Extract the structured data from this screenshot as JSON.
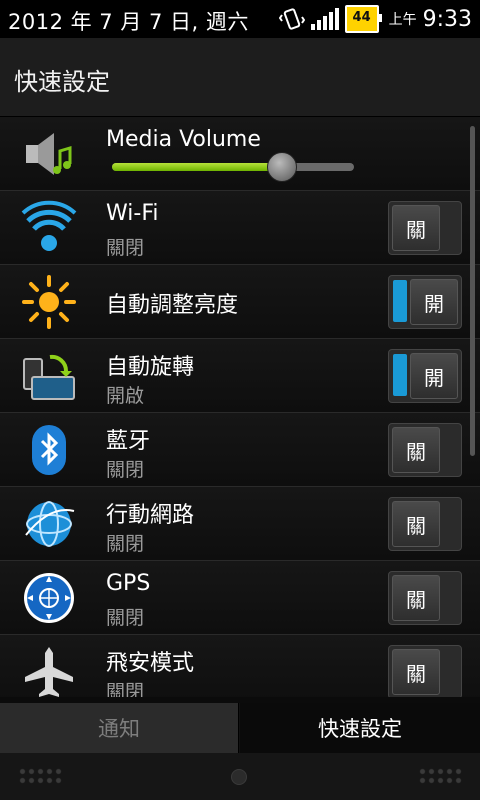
{
  "status": {
    "date": "2012 年 7 月 7 日, 週六",
    "battery": "44",
    "ampm": "上午",
    "time": "9:33"
  },
  "header": {
    "title": "快速設定"
  },
  "media": {
    "title": "Media Volume",
    "volume_fraction": 0.7
  },
  "settings": [
    {
      "title": "Wi-Fi",
      "sub": "關閉",
      "toggle": "關",
      "on": false,
      "icon": "wifi-icon"
    },
    {
      "title": "自動調整亮度",
      "sub": "",
      "toggle": "開",
      "on": true,
      "icon": "sun-icon"
    },
    {
      "title": "自動旋轉",
      "sub": "開啟",
      "toggle": "開",
      "on": true,
      "icon": "rotate-icon"
    },
    {
      "title": "藍牙",
      "sub": "關閉",
      "toggle": "關",
      "on": false,
      "icon": "bluetooth-icon"
    },
    {
      "title": "行動網路",
      "sub": "關閉",
      "toggle": "關",
      "on": false,
      "icon": "globe-icon"
    },
    {
      "title": "GPS",
      "sub": "關閉",
      "toggle": "關",
      "on": false,
      "icon": "gps-icon"
    },
    {
      "title": "飛安模式",
      "sub": "關閉",
      "toggle": "關",
      "on": false,
      "icon": "airplane-icon"
    }
  ],
  "tabs": {
    "notifications": "通知",
    "quick_settings": "快速設定"
  },
  "colors": {
    "accent": "#1a9ad6",
    "slider_green": "#8fd11a"
  }
}
